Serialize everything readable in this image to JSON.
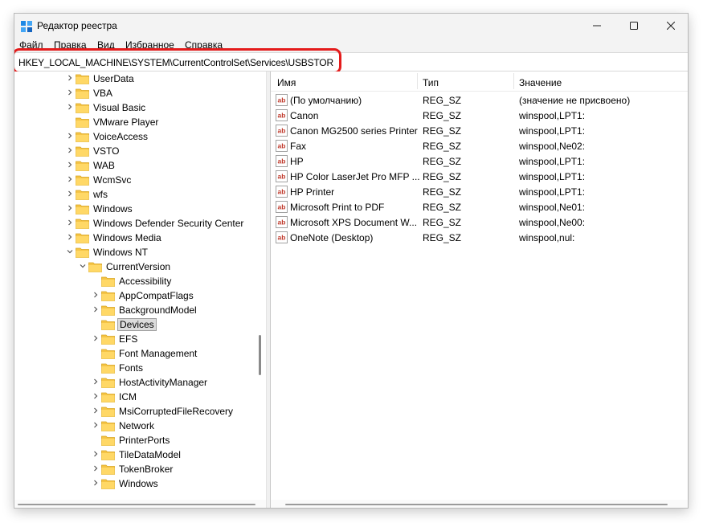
{
  "window": {
    "title": "Редактор реестра"
  },
  "menu": [
    "Файл",
    "Правка",
    "Вид",
    "Избранное",
    "Справка"
  ],
  "address": "HKEY_LOCAL_MACHINE\\SYSTEM\\CurrentControlSet\\Services\\USBSTOR",
  "tree": [
    {
      "label": "UserData",
      "level": 0,
      "chevron": "right"
    },
    {
      "label": "VBA",
      "level": 0,
      "chevron": "right"
    },
    {
      "label": "Visual Basic",
      "level": 0,
      "chevron": "right"
    },
    {
      "label": "VMware Player",
      "level": 0,
      "chevron": ""
    },
    {
      "label": "VoiceAccess",
      "level": 0,
      "chevron": "right"
    },
    {
      "label": "VSTO",
      "level": 0,
      "chevron": "right"
    },
    {
      "label": "WAB",
      "level": 0,
      "chevron": "right"
    },
    {
      "label": "WcmSvc",
      "level": 0,
      "chevron": "right"
    },
    {
      "label": "wfs",
      "level": 0,
      "chevron": "right"
    },
    {
      "label": "Windows",
      "level": 0,
      "chevron": "right"
    },
    {
      "label": "Windows Defender Security Center",
      "level": 0,
      "chevron": "right"
    },
    {
      "label": "Windows Media",
      "level": 0,
      "chevron": "right"
    },
    {
      "label": "Windows NT",
      "level": 0,
      "chevron": "down"
    },
    {
      "label": "CurrentVersion",
      "level": 1,
      "chevron": "down"
    },
    {
      "label": "Accessibility",
      "level": 2,
      "chevron": ""
    },
    {
      "label": "AppCompatFlags",
      "level": 2,
      "chevron": "right"
    },
    {
      "label": "BackgroundModel",
      "level": 2,
      "chevron": "right"
    },
    {
      "label": "Devices",
      "level": 2,
      "chevron": "",
      "selected": true
    },
    {
      "label": "EFS",
      "level": 2,
      "chevron": "right"
    },
    {
      "label": "Font Management",
      "level": 2,
      "chevron": ""
    },
    {
      "label": "Fonts",
      "level": 2,
      "chevron": ""
    },
    {
      "label": "HostActivityManager",
      "level": 2,
      "chevron": "right"
    },
    {
      "label": "ICM",
      "level": 2,
      "chevron": "right"
    },
    {
      "label": "MsiCorruptedFileRecovery",
      "level": 2,
      "chevron": "right"
    },
    {
      "label": "Network",
      "level": 2,
      "chevron": "right"
    },
    {
      "label": "PrinterPorts",
      "level": 2,
      "chevron": ""
    },
    {
      "label": "TileDataModel",
      "level": 2,
      "chevron": "right"
    },
    {
      "label": "TokenBroker",
      "level": 2,
      "chevron": "right"
    },
    {
      "label": "Windows",
      "level": 2,
      "chevron": "right"
    }
  ],
  "list": {
    "headers": {
      "name": "Имя",
      "type": "Тип",
      "value": "Значение"
    },
    "rows": [
      {
        "name": "(По умолчанию)",
        "type": "REG_SZ",
        "value": "(значение не присвоено)"
      },
      {
        "name": "Canon",
        "type": "REG_SZ",
        "value": "winspool,LPT1:"
      },
      {
        "name": "Canon MG2500 series Printer",
        "type": "REG_SZ",
        "value": "winspool,LPT1:"
      },
      {
        "name": "Fax",
        "type": "REG_SZ",
        "value": "winspool,Ne02:"
      },
      {
        "name": "HP",
        "type": "REG_SZ",
        "value": "winspool,LPT1:"
      },
      {
        "name": "HP Color LaserJet Pro MFP ...",
        "type": "REG_SZ",
        "value": "winspool,LPT1:"
      },
      {
        "name": "HP Printer",
        "type": "REG_SZ",
        "value": "winspool,LPT1:"
      },
      {
        "name": "Microsoft Print to PDF",
        "type": "REG_SZ",
        "value": "winspool,Ne01:"
      },
      {
        "name": "Microsoft XPS Document W...",
        "type": "REG_SZ",
        "value": "winspool,Ne00:"
      },
      {
        "name": "OneNote (Desktop)",
        "type": "REG_SZ",
        "value": "winspool,nul:"
      }
    ]
  },
  "colors": {
    "folder": "#f5c445",
    "highlight": "#e41b1b",
    "ab_icon": "#c0392b"
  },
  "icons": [
    "regedit-icon",
    "minimize-icon",
    "maximize-icon",
    "close-icon",
    "chevron-right-icon",
    "chevron-down-icon",
    "folder-icon",
    "string-value-icon"
  ]
}
